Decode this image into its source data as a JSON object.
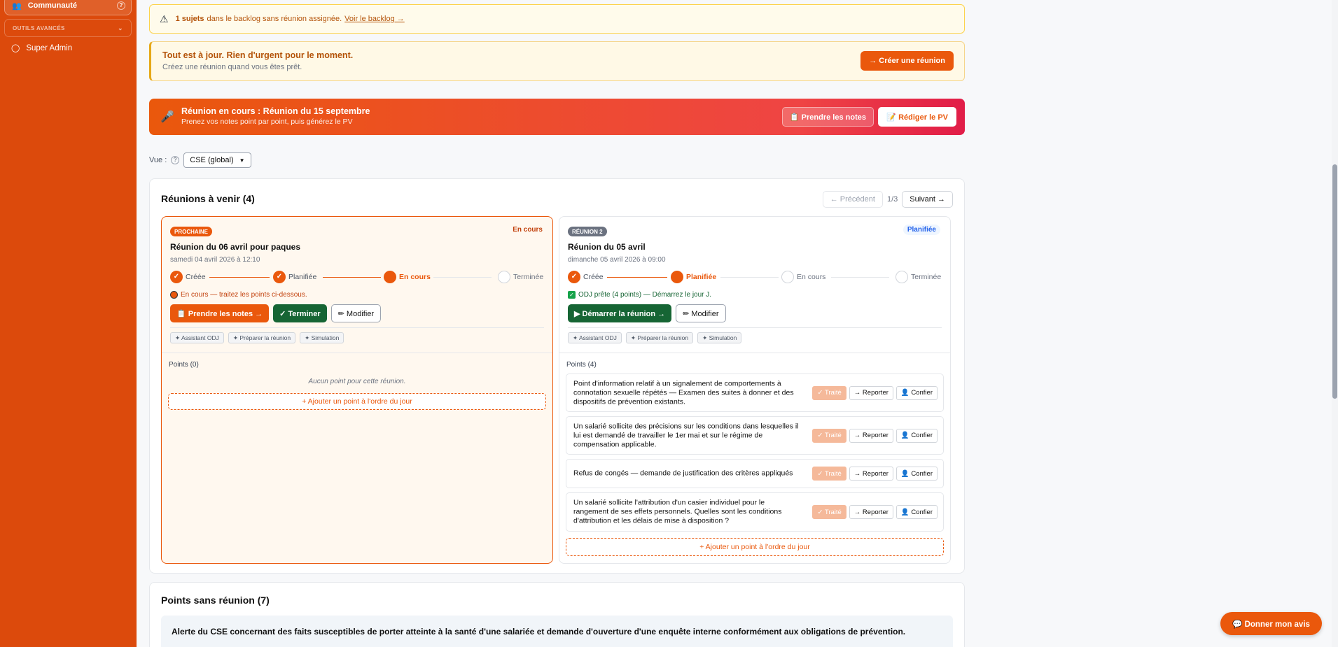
{
  "sidebar": {
    "active_item": "Communauté",
    "section_label": "OUTILS AVANCÉS",
    "admin_item": "Super Admin"
  },
  "warning_banner": {
    "count": "1 sujets",
    "text": "dans le backlog sans réunion assignée.",
    "link": "Voir le backlog →"
  },
  "status_banner": {
    "title": "Tout est à jour. Rien d'urgent pour le moment.",
    "subtitle": "Créez une réunion quand vous êtes prêt.",
    "button": "→ Créer une réunion"
  },
  "live_banner": {
    "title": "Réunion en cours : Réunion du 15 septembre",
    "subtitle": "Prenez vos notes point par point, puis générez le PV",
    "notes_button": "📋 Prendre les notes",
    "pv_button": "📝 Rédiger le PV"
  },
  "view_filter": {
    "label": "Vue :",
    "selected": "CSE (global)"
  },
  "upcoming": {
    "title": "Réunions à venir (4)",
    "prev": "← Précédent",
    "page": "1/3",
    "next": "Suivant →"
  },
  "cards": [
    {
      "badge": "PROCHAINE",
      "status": "En cours",
      "title": "Réunion du 06 avril pour paques",
      "date": "samedi 04 avril 2026 à 12:10",
      "steps": [
        "Créée",
        "Planifiée",
        "En cours",
        "Terminée"
      ],
      "note": "En cours — traitez les points ci-dessous.",
      "actions": [
        "📋 Prendre les notes →",
        "✓ Terminer",
        "✏ Modifier"
      ],
      "tools": [
        "✦ Assistant ODJ",
        "✦ Préparer la réunion",
        "✦ Simulation"
      ],
      "points_title": "Points (0)",
      "empty": "Aucun point pour cette réunion.",
      "add_point": "+ Ajouter un point à l'ordre du jour"
    },
    {
      "badge": "RÉUNION 2",
      "status": "Planifiée",
      "title": "Réunion du 05 avril",
      "date": "dimanche 05 avril 2026 à 09:00",
      "steps": [
        "Créée",
        "Planifiée",
        "En cours",
        "Terminée"
      ],
      "note": "ODJ prête (4 points) — Démarrez le jour J.",
      "actions": [
        "▶ Démarrer la réunion →",
        "✏ Modifier"
      ],
      "tools": [
        "✦ Assistant ODJ",
        "✦ Préparer la réunion",
        "✦ Simulation"
      ],
      "points_title": "Points (4)",
      "points": [
        "Point d'information relatif à un signalement de comportements à connotation sexuelle répétés — Examen des suites à donner et des dispositifs de prévention existants.",
        "Un salarié sollicite des précisions sur les conditions dans lesquelles il lui est demandé de travailler le 1er mai et sur le régime de compensation applicable.",
        "Refus de congés — demande de justification des critères appliqués",
        "Un salarié sollicite l'attribution d'un casier individuel pour le rangement de ses effets personnels. Quelles sont les conditions d'attribution et les délais de mise à disposition ?"
      ],
      "point_buttons": [
        "✓ Traité",
        "→ Reporter",
        "👤 Confier"
      ],
      "add_point": "+ Ajouter un point à l'ordre du jour"
    }
  ],
  "no_meeting": {
    "title": "Points sans réunion (7)",
    "first_item": "Alerte du CSE concernant des faits susceptibles de porter atteinte à la santé d'une salariée et demande d'ouverture d'une enquête interne conformément aux obligations de prévention."
  },
  "feedback_button": "💬 Donner mon avis",
  "colors": {
    "brand": "#ea580c",
    "sidebar": "#dc4a0c",
    "success": "#166534"
  }
}
